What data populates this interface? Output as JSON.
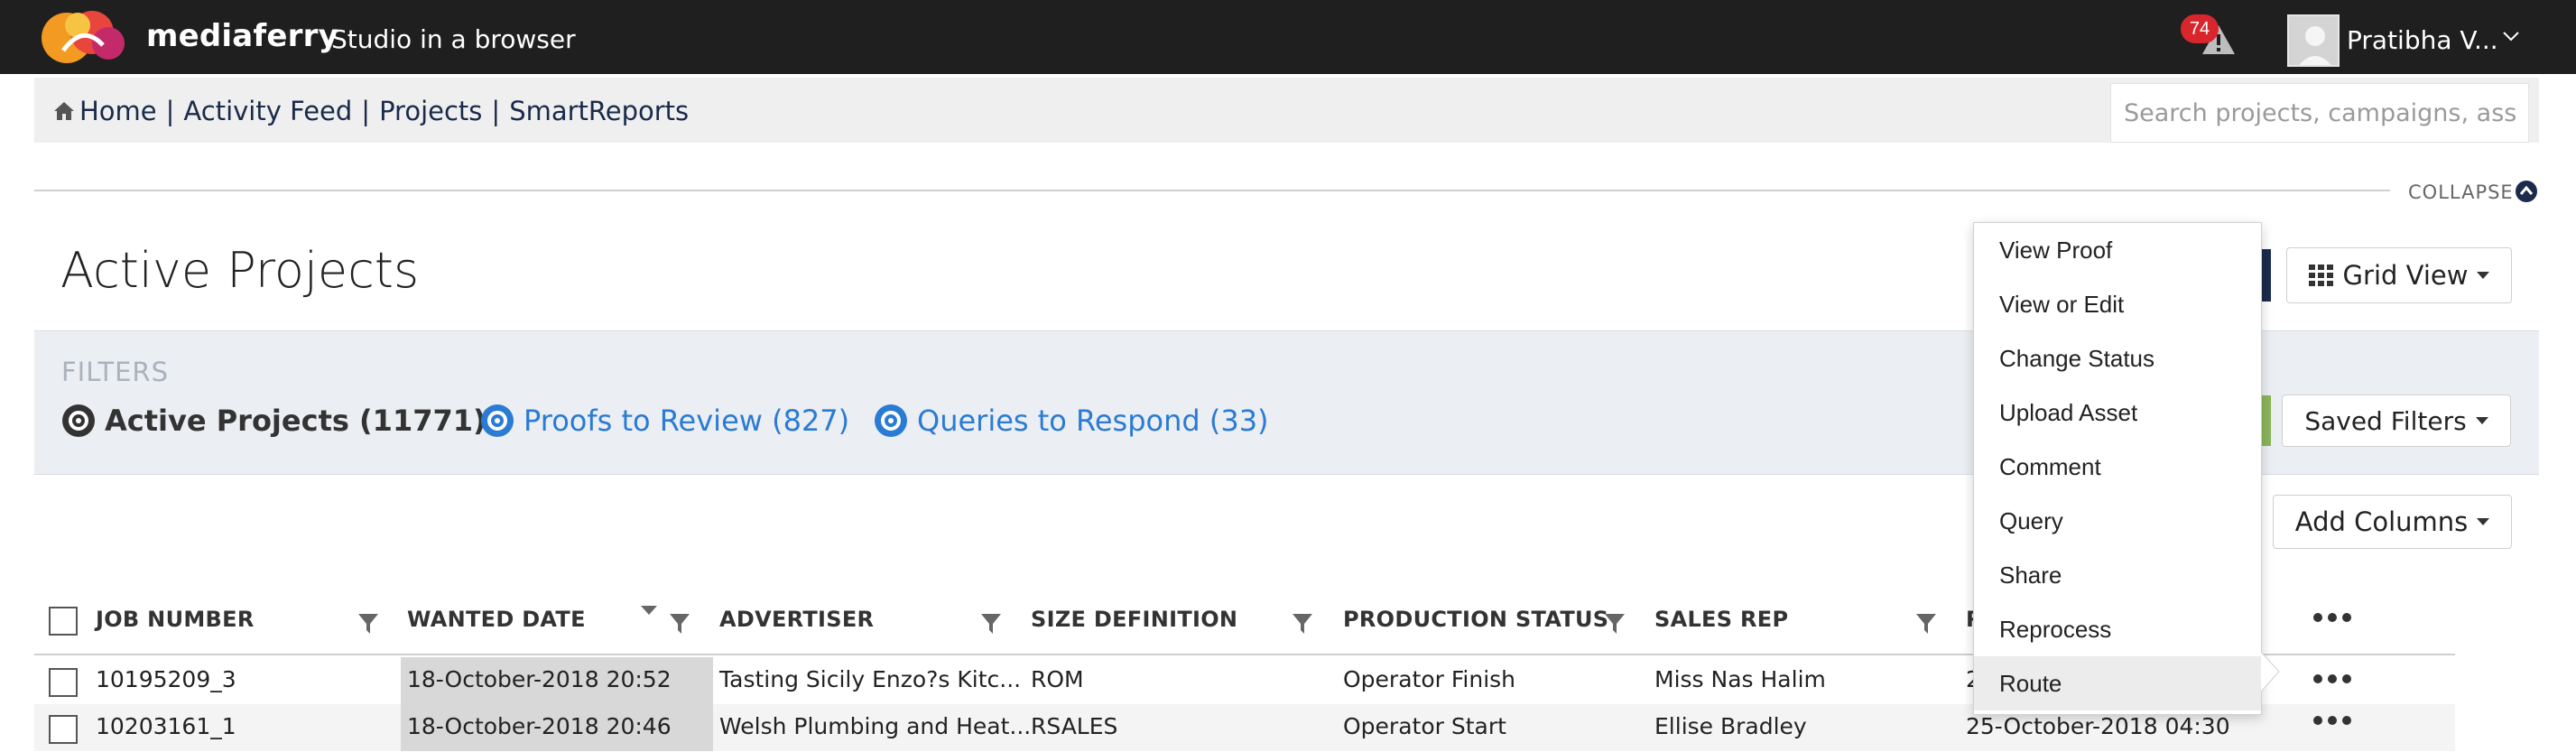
{
  "brand": {
    "name": "mediaferry",
    "tagline": "Studio in a browser"
  },
  "header": {
    "alert_count": "74",
    "user_name": "Pratibha V..."
  },
  "nav": {
    "links": [
      "Home",
      "Activity Feed",
      "Projects",
      "SmartReports"
    ],
    "separator": "|",
    "search_placeholder": "Search projects, campaigns, assets"
  },
  "collapse_label": "COLLAPSE",
  "page_title": "Active Projects",
  "view_button": "Grid View",
  "filters": {
    "heading": "FILTERS",
    "active": "Active Projects (11771)",
    "proofs": "Proofs to Review (827)",
    "queries": "Queries to Respond (33)"
  },
  "saved_filters": "Saved Filters",
  "add_columns": "Add Columns",
  "table": {
    "columns": [
      "JOB NUMBER",
      "WANTED DATE",
      "ADVERTISER",
      "SIZE DEFINITION",
      "PRODUCTION STATUS",
      "SALES REP",
      "R"
    ],
    "rows": [
      {
        "job": "10195209_3",
        "wanted": "18-October-2018 20:52",
        "advertiser": "Tasting Sicily Enzo?s Kitc...",
        "size": "ROM",
        "status": "Operator Finish",
        "rep": "Miss Nas Halim",
        "extra": "2"
      },
      {
        "job": "10203161_1",
        "wanted": "18-October-2018 20:46",
        "advertiser": "Welsh Plumbing and Heat...",
        "size": "RSALES",
        "status": "Operator Start",
        "rep": "Ellise Bradley",
        "extra": "25-October-2018 04:30"
      }
    ]
  },
  "context_menu": {
    "items": [
      "View Proof",
      "View or Edit",
      "Change Status",
      "Upload Asset",
      "Comment",
      "Query",
      "Share",
      "Reprocess",
      "Route"
    ],
    "highlighted": "Route"
  },
  "colors": {
    "topbar": "#1f1f1f",
    "link": "#2a7bd4",
    "badge": "#d9262c",
    "nav_text": "#1a2a4a"
  }
}
